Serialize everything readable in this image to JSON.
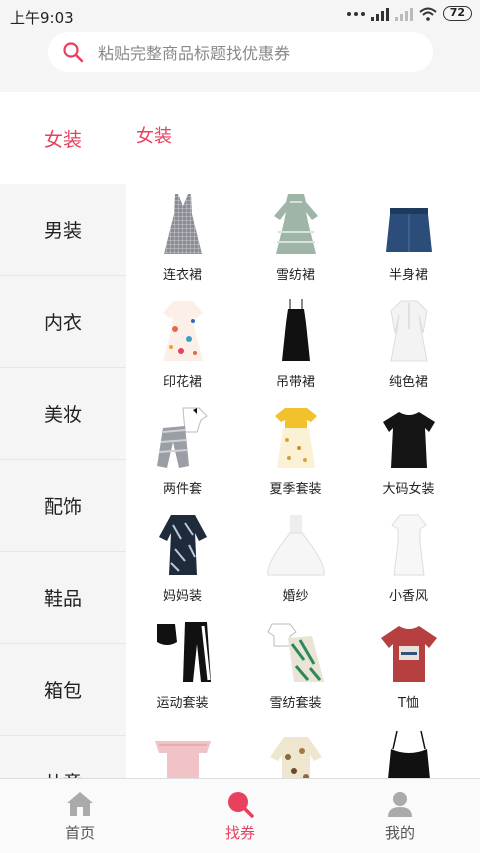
{
  "status": {
    "time": "上午9:03",
    "battery": "72",
    "icons": [
      "more-dots-icon",
      "signal-icon",
      "signal-dim-icon",
      "wifi-icon",
      "battery-icon"
    ]
  },
  "search": {
    "placeholder": "粘贴完整商品标题找优惠券",
    "icon": "search-icon"
  },
  "colors": {
    "accent": "#e8405f",
    "background": "#f5f5f5"
  },
  "sidebar": {
    "items": [
      {
        "label": "女装",
        "active": true
      },
      {
        "label": "男装"
      },
      {
        "label": "内衣"
      },
      {
        "label": "美妆"
      },
      {
        "label": "配饰"
      },
      {
        "label": "鞋品"
      },
      {
        "label": "箱包"
      },
      {
        "label": "儿童"
      }
    ]
  },
  "main": {
    "title": "女装",
    "items": [
      {
        "label": "连衣裙",
        "icon": "plaid-dress-image"
      },
      {
        "label": "雪纺裙",
        "icon": "chiffon-dress-image"
      },
      {
        "label": "半身裙",
        "icon": "denim-skirt-image"
      },
      {
        "label": "印花裙",
        "icon": "printed-dress-image"
      },
      {
        "label": "吊带裙",
        "icon": "slip-dress-image"
      },
      {
        "label": "纯色裙",
        "icon": "solid-dress-image"
      },
      {
        "label": "两件套",
        "icon": "two-piece-image"
      },
      {
        "label": "夏季套装",
        "icon": "summer-set-image"
      },
      {
        "label": "大码女装",
        "icon": "plus-size-tee-image"
      },
      {
        "label": "妈妈装",
        "icon": "mom-wear-image"
      },
      {
        "label": "婚纱",
        "icon": "wedding-dress-image"
      },
      {
        "label": "小香风",
        "icon": "white-dress-image"
      },
      {
        "label": "运动套装",
        "icon": "sport-set-image"
      },
      {
        "label": "雪纺套装",
        "icon": "chiffon-set-image"
      },
      {
        "label": "T恤",
        "icon": "tshirt-image"
      },
      {
        "label": "",
        "icon": "offshoulder-top-image"
      },
      {
        "label": "",
        "icon": "floral-blouse-image"
      },
      {
        "label": "",
        "icon": "camisole-image"
      }
    ]
  },
  "bottom_nav": [
    {
      "label": "首页",
      "icon": "home-icon"
    },
    {
      "label": "找券",
      "icon": "coupon-search-icon",
      "active": true
    },
    {
      "label": "我的",
      "icon": "profile-icon"
    }
  ]
}
